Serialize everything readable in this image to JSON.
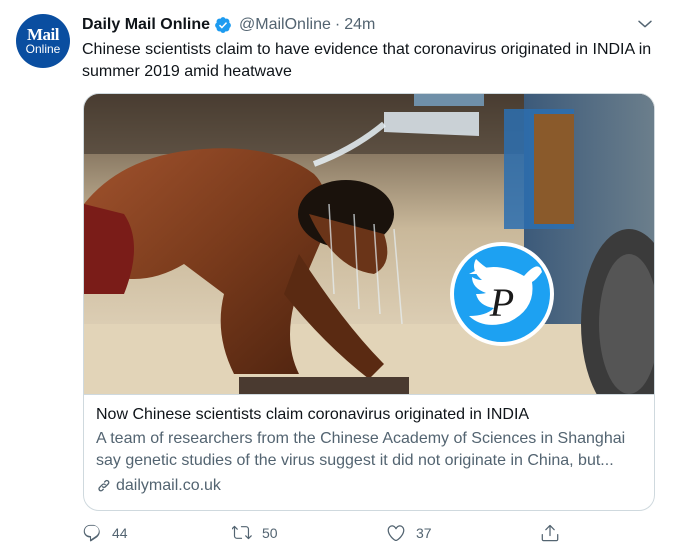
{
  "tweet": {
    "avatar": {
      "line1": "Mail",
      "line2": "Online",
      "color": "#0a4ea0"
    },
    "author": {
      "name": "Daily Mail Online",
      "handle": "@MailOnline",
      "separator": "·",
      "time": "24m",
      "verified": true
    },
    "text": "Chinese scientists claim to have evidence that coronavirus originated in INDIA in summer 2019 amid heatwave",
    "card": {
      "image_alt": "Man bending over as water is poured over his head from a plastic bottle",
      "title": "Now Chinese scientists claim coronavirus originated in INDIA",
      "description": "A team of researchers from the Chinese Academy of Sciences in Shanghai say genetic studies of the virus suggest it did not originate in China, but...",
      "domain": "dailymail.co.uk",
      "watermark_letter": "P"
    },
    "actions": {
      "reply_count": "44",
      "retweet_count": "50",
      "like_count": "37"
    }
  },
  "colors": {
    "text": "#0f1419",
    "secondary": "#536471",
    "verified": "#1d9bf0",
    "border": "#cfd9de"
  }
}
